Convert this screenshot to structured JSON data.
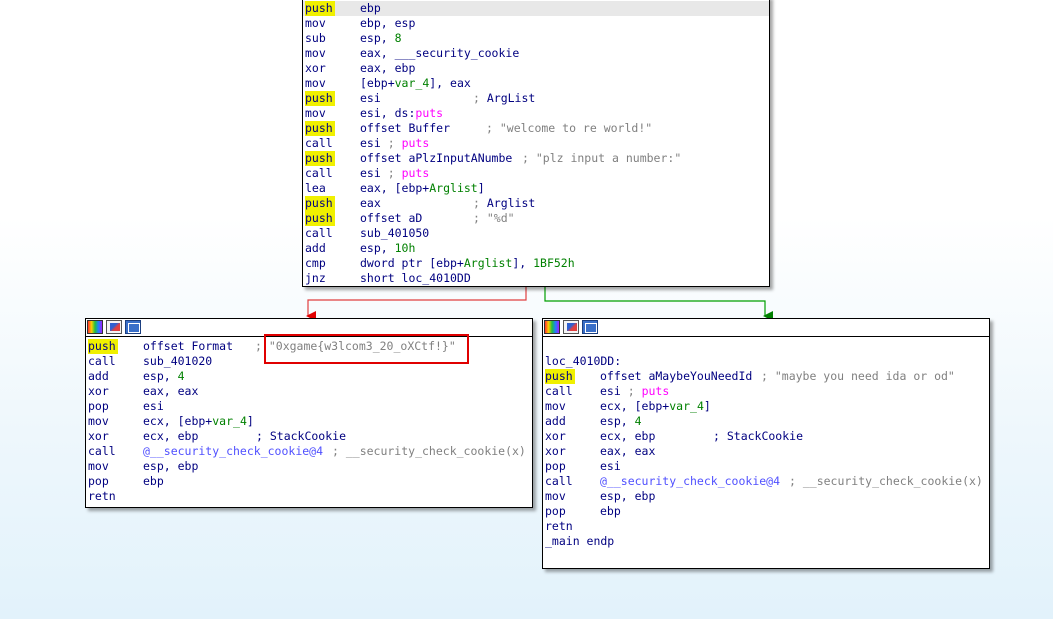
{
  "top_block": {
    "lines": [
      {
        "mn": "push",
        "hl": true,
        "ops": [
          {
            "t": "ebp",
            "c": "plain"
          }
        ],
        "cmt": []
      },
      {
        "mn": "mov",
        "hl": false,
        "ops": [
          {
            "t": "ebp, esp",
            "c": "plain"
          }
        ],
        "cmt": []
      },
      {
        "mn": "sub",
        "hl": false,
        "ops": [
          {
            "t": "esp, ",
            "c": "plain"
          },
          {
            "t": "8",
            "c": "num"
          }
        ],
        "cmt": []
      },
      {
        "mn": "mov",
        "hl": false,
        "ops": [
          {
            "t": "eax, ___security_cookie",
            "c": "plain"
          }
        ],
        "cmt": []
      },
      {
        "mn": "xor",
        "hl": false,
        "ops": [
          {
            "t": "eax, ebp",
            "c": "plain"
          }
        ],
        "cmt": []
      },
      {
        "mn": "mov",
        "hl": false,
        "ops": [
          {
            "t": "[ebp+",
            "c": "plain"
          },
          {
            "t": "var_4",
            "c": "var"
          },
          {
            "t": "], eax",
            "c": "plain"
          }
        ],
        "cmt": []
      },
      {
        "mn": "push",
        "hl": true,
        "ops": [
          {
            "t": "esi",
            "c": "plain"
          }
        ],
        "cmt": [
          {
            "t": "; ",
            "c": "cmt"
          },
          {
            "t": "ArgList",
            "c": "plain"
          }
        ]
      },
      {
        "mn": "mov",
        "hl": false,
        "ops": [
          {
            "t": "esi, ds:",
            "c": "plain"
          },
          {
            "t": "puts",
            "c": "fn"
          }
        ],
        "cmt": []
      },
      {
        "mn": "push",
        "hl": true,
        "ops": [
          {
            "t": "offset Buffer",
            "c": "plain"
          }
        ],
        "cmt": [
          {
            "t": "; \"welcome to re world!\"",
            "c": "cmt"
          }
        ]
      },
      {
        "mn": "call",
        "hl": false,
        "ops": [
          {
            "t": "esi ",
            "c": "plain"
          },
          {
            "t": "; ",
            "c": "cmt"
          },
          {
            "t": "puts",
            "c": "fn"
          }
        ],
        "cmt": []
      },
      {
        "mn": "push",
        "hl": true,
        "ops": [
          {
            "t": "offset aPlzInputANumbe",
            "c": "plain"
          }
        ],
        "cmt": [
          {
            "t": "; \"plz input a number:\"",
            "c": "cmt"
          }
        ]
      },
      {
        "mn": "call",
        "hl": false,
        "ops": [
          {
            "t": "esi ",
            "c": "plain"
          },
          {
            "t": "; ",
            "c": "cmt"
          },
          {
            "t": "puts",
            "c": "fn"
          }
        ],
        "cmt": []
      },
      {
        "mn": "lea",
        "hl": false,
        "ops": [
          {
            "t": "eax, [ebp+",
            "c": "plain"
          },
          {
            "t": "Arglist",
            "c": "var"
          },
          {
            "t": "]",
            "c": "plain"
          }
        ],
        "cmt": []
      },
      {
        "mn": "push",
        "hl": true,
        "ops": [
          {
            "t": "eax",
            "c": "plain"
          }
        ],
        "cmt": [
          {
            "t": "; ",
            "c": "cmt"
          },
          {
            "t": "Arglist",
            "c": "plain"
          }
        ]
      },
      {
        "mn": "push",
        "hl": true,
        "ops": [
          {
            "t": "offset aD",
            "c": "plain"
          }
        ],
        "cmt": [
          {
            "t": "; \"%d\"",
            "c": "cmt"
          }
        ]
      },
      {
        "mn": "call",
        "hl": false,
        "ops": [
          {
            "t": "sub_401050",
            "c": "plain"
          }
        ],
        "cmt": []
      },
      {
        "mn": "add",
        "hl": false,
        "ops": [
          {
            "t": "esp, ",
            "c": "plain"
          },
          {
            "t": "10h",
            "c": "num"
          }
        ],
        "cmt": []
      },
      {
        "mn": "cmp",
        "hl": false,
        "ops": [
          {
            "t": "dword ptr [ebp+",
            "c": "plain"
          },
          {
            "t": "Arglist",
            "c": "var"
          },
          {
            "t": "], ",
            "c": "plain"
          },
          {
            "t": "1BF52h",
            "c": "num"
          }
        ],
        "cmt": []
      },
      {
        "mn": "jnz",
        "hl": false,
        "ops": [
          {
            "t": "short loc_4010DD",
            "c": "plain"
          }
        ],
        "cmt": []
      }
    ]
  },
  "left_block": {
    "lines": [
      {
        "mn": "push",
        "hl": true,
        "ops": [
          {
            "t": "offset Format",
            "c": "plain"
          }
        ],
        "cmt": [
          {
            "t": "; \"0xgame{w3lcom3_20_oXCtf!}\"",
            "c": "cmt"
          }
        ]
      },
      {
        "mn": "call",
        "hl": false,
        "ops": [
          {
            "t": "sub_401020",
            "c": "plain"
          }
        ],
        "cmt": []
      },
      {
        "mn": "add",
        "hl": false,
        "ops": [
          {
            "t": "esp, ",
            "c": "plain"
          },
          {
            "t": "4",
            "c": "num"
          }
        ],
        "cmt": []
      },
      {
        "mn": "xor",
        "hl": false,
        "ops": [
          {
            "t": "eax, eax",
            "c": "plain"
          }
        ],
        "cmt": []
      },
      {
        "mn": "pop",
        "hl": false,
        "ops": [
          {
            "t": "esi",
            "c": "plain"
          }
        ],
        "cmt": []
      },
      {
        "mn": "mov",
        "hl": false,
        "ops": [
          {
            "t": "ecx, [ebp+",
            "c": "plain"
          },
          {
            "t": "var_4",
            "c": "var"
          },
          {
            "t": "]",
            "c": "plain"
          }
        ],
        "cmt": []
      },
      {
        "mn": "xor",
        "hl": false,
        "ops": [
          {
            "t": "ecx, ebp",
            "c": "plain"
          }
        ],
        "cmt": [
          {
            "t": "; StackCookie",
            "c": "plain"
          }
        ]
      },
      {
        "mn": "call",
        "hl": false,
        "ops": [
          {
            "t": "@__security_check_cookie@4",
            "c": "func"
          }
        ],
        "cmt": [
          {
            "t": "; __security_check_cookie(x)",
            "c": "cmt"
          }
        ]
      },
      {
        "mn": "mov",
        "hl": false,
        "ops": [
          {
            "t": "esp, ebp",
            "c": "plain"
          }
        ],
        "cmt": []
      },
      {
        "mn": "pop",
        "hl": false,
        "ops": [
          {
            "t": "ebp",
            "c": "plain"
          }
        ],
        "cmt": []
      },
      {
        "mn": "retn",
        "hl": false,
        "ops": [],
        "cmt": []
      }
    ]
  },
  "right_block": {
    "label": "loc_4010DD:",
    "endp": "_main endp",
    "lines": [
      {
        "mn": "push",
        "hl": true,
        "ops": [
          {
            "t": "offset aMaybeYouNeedId",
            "c": "plain"
          }
        ],
        "cmt": [
          {
            "t": "; \"maybe you need ida or od\"",
            "c": "cmt"
          }
        ]
      },
      {
        "mn": "call",
        "hl": false,
        "ops": [
          {
            "t": "esi ",
            "c": "plain"
          },
          {
            "t": "; ",
            "c": "cmt"
          },
          {
            "t": "puts",
            "c": "fn"
          }
        ],
        "cmt": []
      },
      {
        "mn": "mov",
        "hl": false,
        "ops": [
          {
            "t": "ecx, [ebp+",
            "c": "plain"
          },
          {
            "t": "var_4",
            "c": "var"
          },
          {
            "t": "]",
            "c": "plain"
          }
        ],
        "cmt": []
      },
      {
        "mn": "add",
        "hl": false,
        "ops": [
          {
            "t": "esp, ",
            "c": "plain"
          },
          {
            "t": "4",
            "c": "num"
          }
        ],
        "cmt": []
      },
      {
        "mn": "xor",
        "hl": false,
        "ops": [
          {
            "t": "ecx, ebp",
            "c": "plain"
          }
        ],
        "cmt": [
          {
            "t": "; StackCookie",
            "c": "plain"
          }
        ]
      },
      {
        "mn": "xor",
        "hl": false,
        "ops": [
          {
            "t": "eax, eax",
            "c": "plain"
          }
        ],
        "cmt": []
      },
      {
        "mn": "pop",
        "hl": false,
        "ops": [
          {
            "t": "esi",
            "c": "plain"
          }
        ],
        "cmt": []
      },
      {
        "mn": "call",
        "hl": false,
        "ops": [
          {
            "t": "@__security_check_cookie@4",
            "c": "func"
          }
        ],
        "cmt": [
          {
            "t": "; __security_check_cookie(x)",
            "c": "cmt"
          }
        ]
      },
      {
        "mn": "mov",
        "hl": false,
        "ops": [
          {
            "t": "esp, ebp",
            "c": "plain"
          }
        ],
        "cmt": []
      },
      {
        "mn": "pop",
        "hl": false,
        "ops": [
          {
            "t": "ebp",
            "c": "plain"
          }
        ],
        "cmt": []
      },
      {
        "mn": "retn",
        "hl": false,
        "ops": [],
        "cmt": []
      }
    ]
  },
  "colors": {
    "false_edge": "#e04040",
    "true_edge": "#00a000",
    "highlight_box": "#e00000",
    "mnemonic_highlight": "#f0f000"
  }
}
